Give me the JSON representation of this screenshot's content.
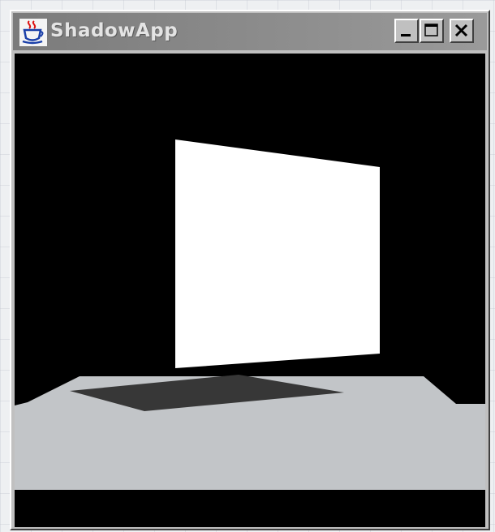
{
  "window": {
    "title": "ShadowApp",
    "icon": "java-cup-icon",
    "controls": {
      "minimize_icon": "minimize-icon",
      "maximize_icon": "maximize-icon",
      "close_icon": "close-icon"
    }
  },
  "scene": {
    "background_color": "#000000",
    "panel_color": "#ffffff",
    "floor_color": "#c2c5c8",
    "shadow_color": "#373737"
  },
  "colors": {
    "titlebar": "#7b7b7b",
    "title_text": "#e4e4e4",
    "window_frame": "#c0c0c0"
  }
}
